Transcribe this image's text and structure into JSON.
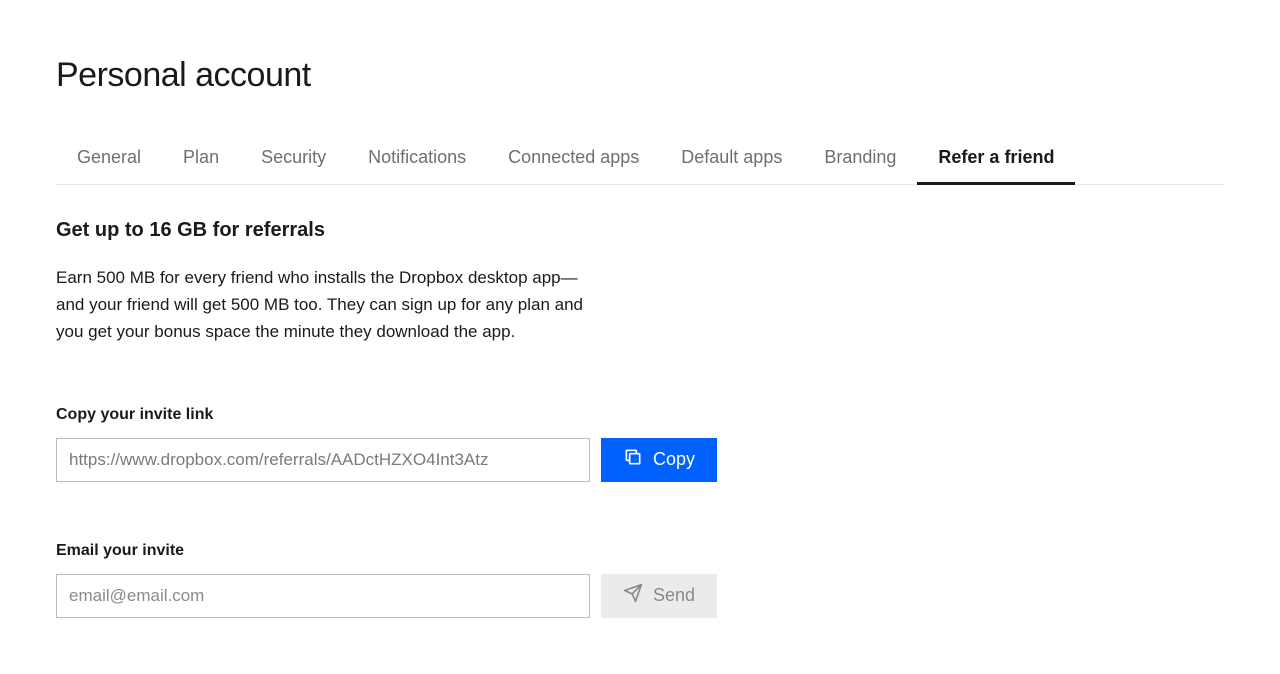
{
  "page": {
    "title": "Personal account"
  },
  "tabs": [
    {
      "label": "General",
      "active": false
    },
    {
      "label": "Plan",
      "active": false
    },
    {
      "label": "Security",
      "active": false
    },
    {
      "label": "Notifications",
      "active": false
    },
    {
      "label": "Connected apps",
      "active": false
    },
    {
      "label": "Default apps",
      "active": false
    },
    {
      "label": "Branding",
      "active": false
    },
    {
      "label": "Refer a friend",
      "active": true
    }
  ],
  "referral": {
    "heading": "Get up to 16 GB for referrals",
    "description": "Earn 500 MB for every friend who installs the Dropbox desktop app—and your friend will get 500 MB too. They can sign up for any plan and you get your bonus space the minute they download the app.",
    "copy_section": {
      "label": "Copy your invite link",
      "link_value": "https://www.dropbox.com/referrals/AADctHZXO4Int3Atz",
      "button_label": "Copy"
    },
    "email_section": {
      "label": "Email your invite",
      "placeholder": "email@email.com",
      "value": "",
      "button_label": "Send"
    }
  }
}
